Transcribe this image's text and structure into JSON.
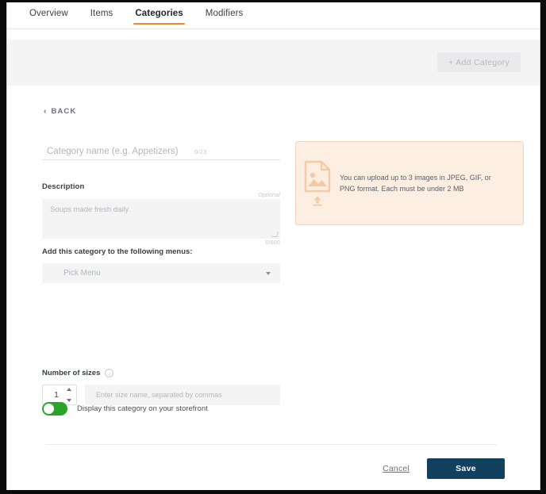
{
  "tabs": [
    {
      "label": "Overview",
      "active": false
    },
    {
      "label": "Items",
      "active": false
    },
    {
      "label": "Categories",
      "active": true
    },
    {
      "label": "Modifiers",
      "active": false
    }
  ],
  "header": {
    "add_category_label": "+ Add Category"
  },
  "back": {
    "chevron": "‹",
    "label": "BACK"
  },
  "form": {
    "category_name": {
      "value": "",
      "placeholder": "Category name (e.g. Appetizers)",
      "char_count": "0/23",
      "info_icon": "i"
    },
    "description": {
      "label": "Description",
      "optional_tag": "Optional",
      "value": "",
      "placeholder": "Soups made fresh daily.",
      "char_count": "0/600"
    },
    "menus": {
      "label": "Add this category to the following menus:",
      "selected": "Pick Menu"
    },
    "sizes": {
      "label": "Number of sizes",
      "info_icon": "i",
      "count": "1",
      "names_value": "",
      "names_placeholder": "Enter size name, separated by commas"
    },
    "storefront_toggle": {
      "label": "Display this category on your storefront",
      "state": "on"
    }
  },
  "upload": {
    "icon": "image-upload-icon",
    "text": "You can upload up to 3 images in JPEG, GIF, or PNG format. Each must be under 2 MB"
  },
  "footer": {
    "cancel_label": "Cancel",
    "save_label": "Save"
  },
  "colors": {
    "accent_orange": "#f08a24",
    "upload_bg": "#fdeee2",
    "upload_border": "#f3d5bd",
    "toggle_green": "#2aa52a",
    "save_navy": "#12415f"
  }
}
